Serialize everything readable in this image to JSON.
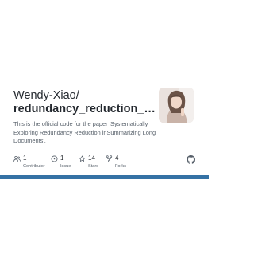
{
  "repo_card": {
    "owner": "Wendy-Xiao/",
    "repo_name": "redundancy_reduction_l...",
    "description": "This is the official code for the paper 'Systematically Exploring Redundancy Reduction inSummarizing Long Documents'.",
    "avatar_icon": "user-photo-avatar",
    "stats": [
      {
        "value": "1",
        "label": "Contributor",
        "icon": "people-icon"
      },
      {
        "value": "1",
        "label": "Issue",
        "icon": "issue-icon"
      },
      {
        "value": "14",
        "label": "Stars",
        "icon": "star-icon"
      },
      {
        "value": "4",
        "label": "Forks",
        "icon": "fork-icon"
      }
    ],
    "brand_icon": "github-icon",
    "language_bar_color": "#3572a5"
  }
}
